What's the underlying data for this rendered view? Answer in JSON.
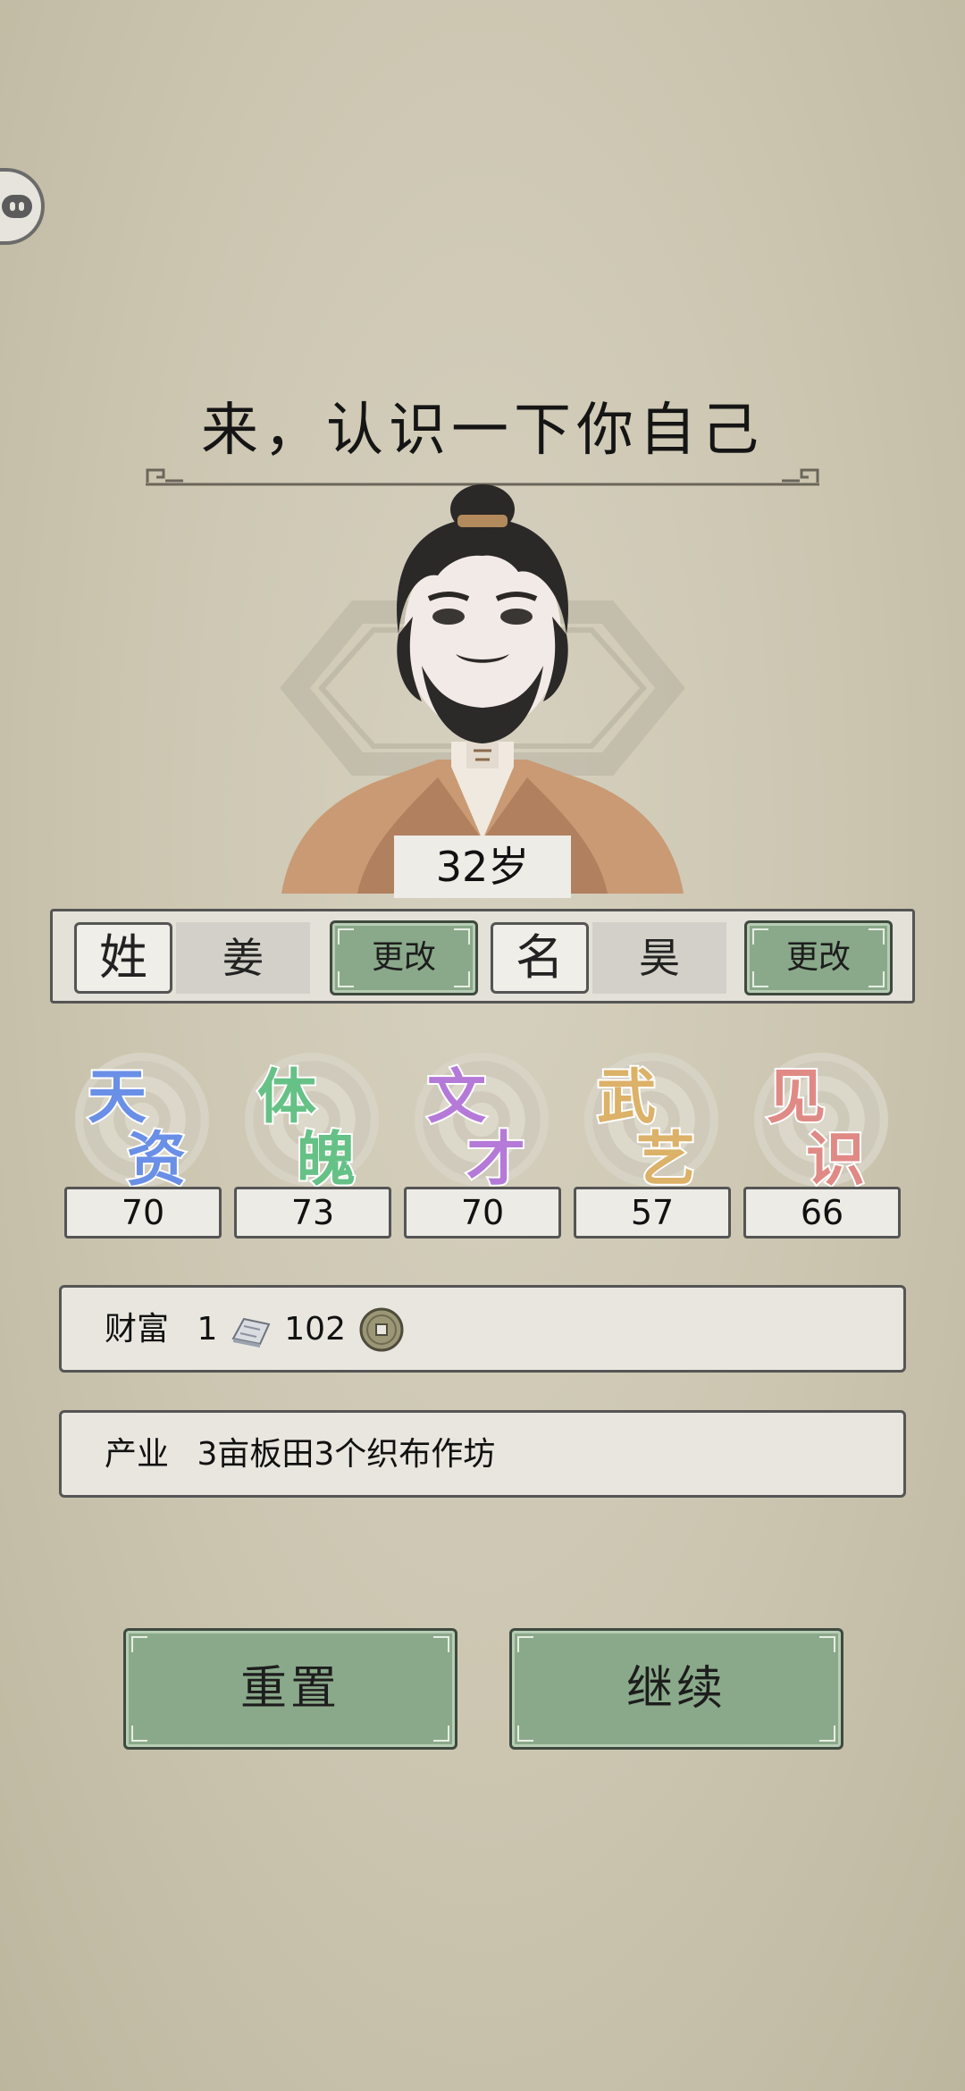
{
  "header": {
    "title": "来，认识一下你自己"
  },
  "character": {
    "age": "32岁"
  },
  "name_panel": {
    "surname_label": "姓",
    "surname_value": "姜",
    "given_label": "名",
    "given_value": "昊",
    "change_label": "更改"
  },
  "stats": [
    {
      "chars": [
        "天",
        "资"
      ],
      "value": "70",
      "color": "#6a8fe6"
    },
    {
      "chars": [
        "体",
        "魄"
      ],
      "value": "73",
      "color": "#66c186"
    },
    {
      "chars": [
        "文",
        "才"
      ],
      "value": "70",
      "color": "#b57ad8"
    },
    {
      "chars": [
        "武",
        "艺"
      ],
      "value": "57",
      "color": "#dcb168"
    },
    {
      "chars": [
        "见",
        "识"
      ],
      "value": "66",
      "color": "#e08a86"
    }
  ],
  "wealth": {
    "label": "财富",
    "silver": "1",
    "coins": "102"
  },
  "property": {
    "label": "产业",
    "value": "3亩板田3个织布作坊"
  },
  "actions": {
    "reset": "重置",
    "continue": "继续"
  }
}
